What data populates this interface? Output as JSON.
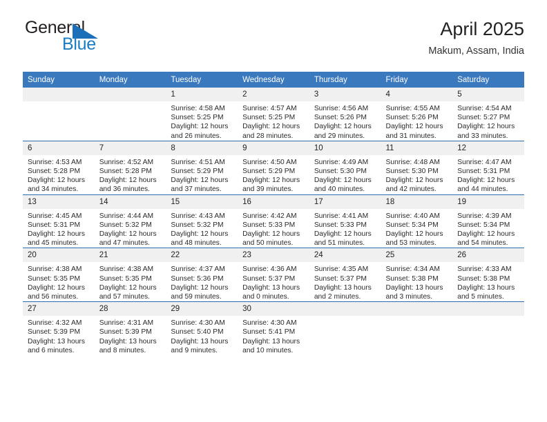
{
  "brand": {
    "name_top": "General",
    "name_bottom": "Blue",
    "accent_color": "#1a7dc4",
    "flag_color": "#1a6fb8"
  },
  "header": {
    "title": "April 2025",
    "subtitle": "Makum, Assam, India"
  },
  "theme": {
    "header_bar_color": "#3b79bf",
    "row_divider_color": "#2b6cb0",
    "daynum_band_color": "#f0f0f0"
  },
  "weekdays": [
    "Sunday",
    "Monday",
    "Tuesday",
    "Wednesday",
    "Thursday",
    "Friday",
    "Saturday"
  ],
  "weeks": [
    [
      {
        "day": "",
        "empty": true
      },
      {
        "day": "",
        "empty": true
      },
      {
        "day": "1",
        "sunrise": "Sunrise: 4:58 AM",
        "sunset": "Sunset: 5:25 PM",
        "daylight": "Daylight: 12 hours and 26 minutes."
      },
      {
        "day": "2",
        "sunrise": "Sunrise: 4:57 AM",
        "sunset": "Sunset: 5:25 PM",
        "daylight": "Daylight: 12 hours and 28 minutes."
      },
      {
        "day": "3",
        "sunrise": "Sunrise: 4:56 AM",
        "sunset": "Sunset: 5:26 PM",
        "daylight": "Daylight: 12 hours and 29 minutes."
      },
      {
        "day": "4",
        "sunrise": "Sunrise: 4:55 AM",
        "sunset": "Sunset: 5:26 PM",
        "daylight": "Daylight: 12 hours and 31 minutes."
      },
      {
        "day": "5",
        "sunrise": "Sunrise: 4:54 AM",
        "sunset": "Sunset: 5:27 PM",
        "daylight": "Daylight: 12 hours and 33 minutes."
      }
    ],
    [
      {
        "day": "6",
        "sunrise": "Sunrise: 4:53 AM",
        "sunset": "Sunset: 5:28 PM",
        "daylight": "Daylight: 12 hours and 34 minutes."
      },
      {
        "day": "7",
        "sunrise": "Sunrise: 4:52 AM",
        "sunset": "Sunset: 5:28 PM",
        "daylight": "Daylight: 12 hours and 36 minutes."
      },
      {
        "day": "8",
        "sunrise": "Sunrise: 4:51 AM",
        "sunset": "Sunset: 5:29 PM",
        "daylight": "Daylight: 12 hours and 37 minutes."
      },
      {
        "day": "9",
        "sunrise": "Sunrise: 4:50 AM",
        "sunset": "Sunset: 5:29 PM",
        "daylight": "Daylight: 12 hours and 39 minutes."
      },
      {
        "day": "10",
        "sunrise": "Sunrise: 4:49 AM",
        "sunset": "Sunset: 5:30 PM",
        "daylight": "Daylight: 12 hours and 40 minutes."
      },
      {
        "day": "11",
        "sunrise": "Sunrise: 4:48 AM",
        "sunset": "Sunset: 5:30 PM",
        "daylight": "Daylight: 12 hours and 42 minutes."
      },
      {
        "day": "12",
        "sunrise": "Sunrise: 4:47 AM",
        "sunset": "Sunset: 5:31 PM",
        "daylight": "Daylight: 12 hours and 44 minutes."
      }
    ],
    [
      {
        "day": "13",
        "sunrise": "Sunrise: 4:45 AM",
        "sunset": "Sunset: 5:31 PM",
        "daylight": "Daylight: 12 hours and 45 minutes."
      },
      {
        "day": "14",
        "sunrise": "Sunrise: 4:44 AM",
        "sunset": "Sunset: 5:32 PM",
        "daylight": "Daylight: 12 hours and 47 minutes."
      },
      {
        "day": "15",
        "sunrise": "Sunrise: 4:43 AM",
        "sunset": "Sunset: 5:32 PM",
        "daylight": "Daylight: 12 hours and 48 minutes."
      },
      {
        "day": "16",
        "sunrise": "Sunrise: 4:42 AM",
        "sunset": "Sunset: 5:33 PM",
        "daylight": "Daylight: 12 hours and 50 minutes."
      },
      {
        "day": "17",
        "sunrise": "Sunrise: 4:41 AM",
        "sunset": "Sunset: 5:33 PM",
        "daylight": "Daylight: 12 hours and 51 minutes."
      },
      {
        "day": "18",
        "sunrise": "Sunrise: 4:40 AM",
        "sunset": "Sunset: 5:34 PM",
        "daylight": "Daylight: 12 hours and 53 minutes."
      },
      {
        "day": "19",
        "sunrise": "Sunrise: 4:39 AM",
        "sunset": "Sunset: 5:34 PM",
        "daylight": "Daylight: 12 hours and 54 minutes."
      }
    ],
    [
      {
        "day": "20",
        "sunrise": "Sunrise: 4:38 AM",
        "sunset": "Sunset: 5:35 PM",
        "daylight": "Daylight: 12 hours and 56 minutes."
      },
      {
        "day": "21",
        "sunrise": "Sunrise: 4:38 AM",
        "sunset": "Sunset: 5:35 PM",
        "daylight": "Daylight: 12 hours and 57 minutes."
      },
      {
        "day": "22",
        "sunrise": "Sunrise: 4:37 AM",
        "sunset": "Sunset: 5:36 PM",
        "daylight": "Daylight: 12 hours and 59 minutes."
      },
      {
        "day": "23",
        "sunrise": "Sunrise: 4:36 AM",
        "sunset": "Sunset: 5:37 PM",
        "daylight": "Daylight: 13 hours and 0 minutes."
      },
      {
        "day": "24",
        "sunrise": "Sunrise: 4:35 AM",
        "sunset": "Sunset: 5:37 PM",
        "daylight": "Daylight: 13 hours and 2 minutes."
      },
      {
        "day": "25",
        "sunrise": "Sunrise: 4:34 AM",
        "sunset": "Sunset: 5:38 PM",
        "daylight": "Daylight: 13 hours and 3 minutes."
      },
      {
        "day": "26",
        "sunrise": "Sunrise: 4:33 AM",
        "sunset": "Sunset: 5:38 PM",
        "daylight": "Daylight: 13 hours and 5 minutes."
      }
    ],
    [
      {
        "day": "27",
        "sunrise": "Sunrise: 4:32 AM",
        "sunset": "Sunset: 5:39 PM",
        "daylight": "Daylight: 13 hours and 6 minutes."
      },
      {
        "day": "28",
        "sunrise": "Sunrise: 4:31 AM",
        "sunset": "Sunset: 5:39 PM",
        "daylight": "Daylight: 13 hours and 8 minutes."
      },
      {
        "day": "29",
        "sunrise": "Sunrise: 4:30 AM",
        "sunset": "Sunset: 5:40 PM",
        "daylight": "Daylight: 13 hours and 9 minutes."
      },
      {
        "day": "30",
        "sunrise": "Sunrise: 4:30 AM",
        "sunset": "Sunset: 5:41 PM",
        "daylight": "Daylight: 13 hours and 10 minutes."
      },
      {
        "day": "",
        "empty": true
      },
      {
        "day": "",
        "empty": true
      },
      {
        "day": "",
        "empty": true
      }
    ]
  ]
}
